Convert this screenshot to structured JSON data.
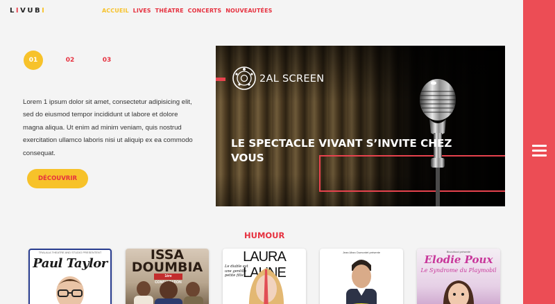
{
  "header": {
    "logo": {
      "l": "L",
      "i": "I",
      "vub": "VUB",
      "end": "I"
    },
    "nav": [
      "ACCUEIL",
      "LIVES",
      "THÉATRE",
      "CONCERTS",
      "NOUVEAUTÉES"
    ]
  },
  "slider": {
    "pages": [
      "01",
      "02",
      "03"
    ],
    "active_page": "01",
    "intro": "Lorem 1 ipsum dolor sit amet, consectetur adipisicing elit, sed do eiusmod tempor incididunt ut labore et dolore magna aliqua. Ut enim ad minim veniam, quis nostrud exercitation ullamco laboris nisi ut aliquip ex ea commodo consequat.",
    "cta": "DÉCOUVRIR"
  },
  "hero": {
    "brand": "2AL SCREEN",
    "headline": "LE SPECTACLE VIVANT S’INVITE CHEZ VOUS"
  },
  "section": {
    "title": "HUMOUR"
  },
  "posters": {
    "paul_taylor": {
      "small": "TRALALA THEATRE AND STUDIO PRESENTENT",
      "title": "Paul Taylor"
    },
    "issa": {
      "title1": "ISSA",
      "title2": "DOUMBIA",
      "badge": "1ère CONSULTATION"
    },
    "laura": {
      "title": "LAURA LAUNE",
      "sub": "Le diable est une gentille petite fille"
    },
    "jean_marc": {
      "small": "Jean-Marc Dumontet présente"
    },
    "elodie": {
      "small": "Bisoufood présente",
      "title": "Elodie Poux",
      "sub": "Le Syndrome du Playmobil"
    }
  },
  "colors": {
    "red": "#e6313f",
    "yellow": "#f7c22a",
    "sidebar": "#ec4d55"
  },
  "icons": {
    "menu": "hamburger-icon",
    "brand": "film-reel-icon"
  }
}
